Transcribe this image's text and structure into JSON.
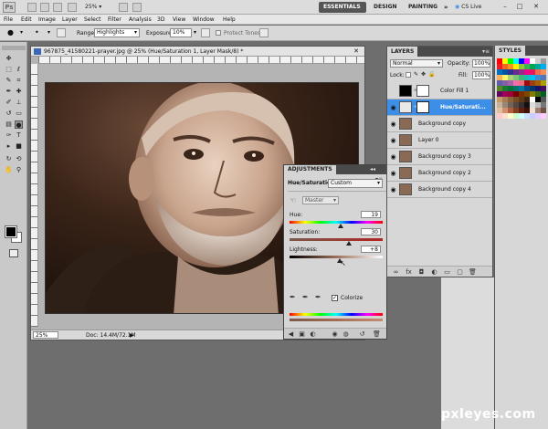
{
  "app": {
    "logo": "Ps",
    "zoom": "25%"
  },
  "workspaces": {
    "essentials": "ESSENTIALS",
    "design": "DESIGN",
    "painting": "PAINTING",
    "more": "»",
    "cs_live": "CS Live"
  },
  "window_controls": {
    "minimize": "–",
    "restore": "□",
    "close": "✕"
  },
  "menu": [
    "File",
    "Edit",
    "Image",
    "Layer",
    "Select",
    "Filter",
    "Analysis",
    "3D",
    "View",
    "Window",
    "Help"
  ],
  "options_bar": {
    "range_label": "Range:",
    "range_value": "Highlights",
    "exposure_label": "Exposure:",
    "exposure_value": "10%",
    "protect_tones": "Protect Tones"
  },
  "document": {
    "title": "967875_41580221-prayer.jpg @ 25% (Hue/Saturation 1, Layer Mask/8) *",
    "close": "✕",
    "status_zoom": "25%",
    "status_info": "Doc: 14.4M/72.1M",
    "status_arrow": "▶"
  },
  "adjustments": {
    "tab": "ADJUSTMENTS",
    "collapse": "◂◂",
    "menu": "▾≡",
    "type": "Hue/Saturation",
    "preset": "Custom",
    "channel": "Master",
    "hue_label": "Hue:",
    "hue": "19",
    "saturation_label": "Saturation:",
    "saturation": "30",
    "lightness_label": "Lightness:",
    "lightness": "+8",
    "colorize": "Colorize",
    "hue_pos": 0.55,
    "sat_pos": 0.64,
    "light_pos": 0.54
  },
  "layers": {
    "tab": "LAYERS",
    "blend_mode": "Normal",
    "opacity_label": "Opacity:",
    "opacity": "100%",
    "lock_label": "Lock:",
    "fill_label": "Fill:",
    "fill": "100%",
    "items": [
      {
        "name": "Color Fill 1",
        "visible": false,
        "selected": false
      },
      {
        "name": "Hue/Saturati...",
        "visible": true,
        "selected": true
      },
      {
        "name": "Background copy",
        "visible": true,
        "selected": false
      },
      {
        "name": "Layer 0",
        "visible": true,
        "selected": false
      },
      {
        "name": "Background copy 3",
        "visible": true,
        "selected": false
      },
      {
        "name": "Background copy 2",
        "visible": true,
        "selected": false
      },
      {
        "name": "Background copy 4",
        "visible": true,
        "selected": false
      }
    ]
  },
  "swatches": {
    "tab": "STYLES"
  },
  "watermark": "pxleyes.com",
  "colors": {
    "accent": "#3d8ee6",
    "sepia_dark": "#2a1a12",
    "sepia_light": "#e8d2c0"
  }
}
